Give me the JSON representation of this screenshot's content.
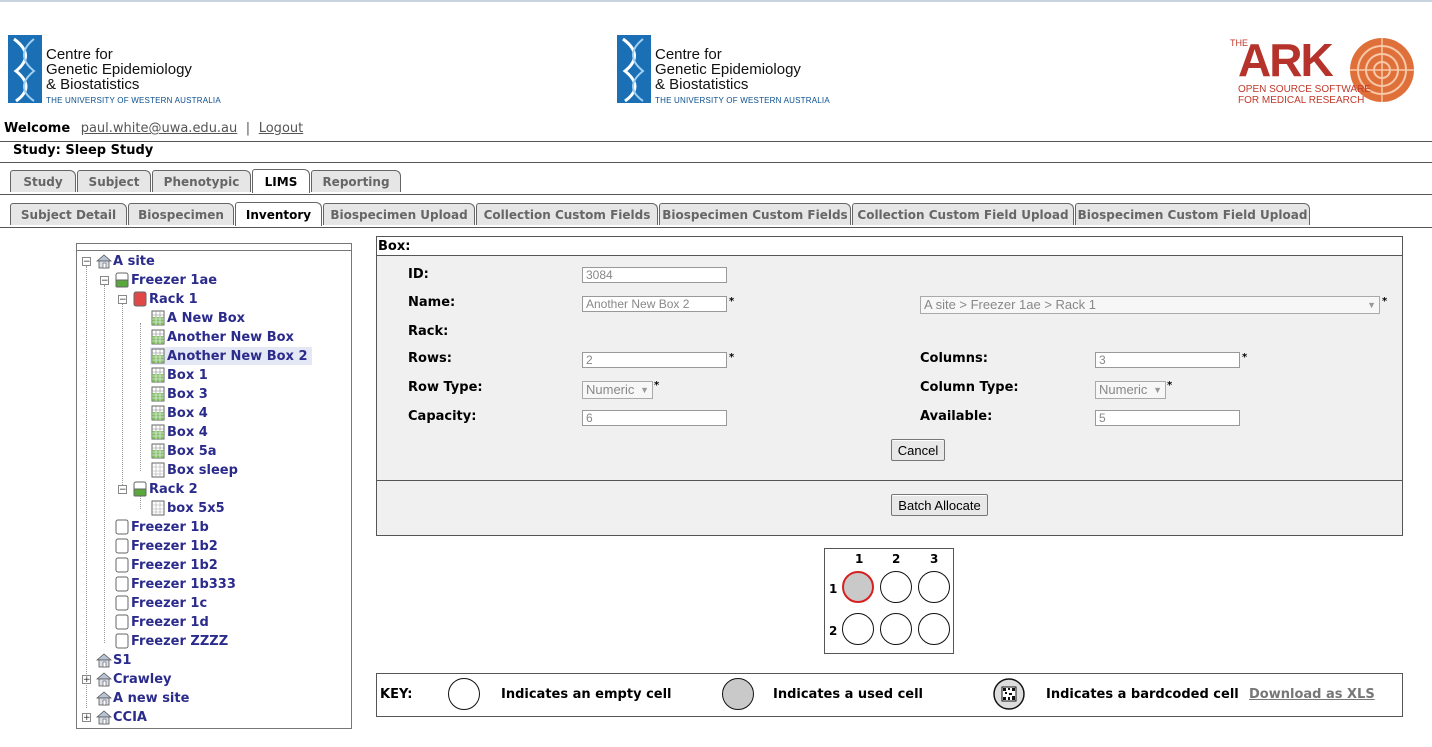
{
  "header": {
    "logo1": {
      "line1": "Centre for",
      "line2": "Genetic Epidemiology",
      "line3": "& Biostatistics",
      "line4": "THE UNIVERSITY OF WESTERN AUSTRALIA"
    },
    "logo2": {
      "line1": "Centre for",
      "line2": "Genetic Epidemiology",
      "line3": "& Biostatistics",
      "line4": "THE UNIVERSITY OF WESTERN AUSTRALIA"
    },
    "ark": {
      "the": "THE",
      "word": "ARK",
      "sub1": "OPEN SOURCE SOFTWARE",
      "sub2": "FOR MEDICAL RESEARCH"
    }
  },
  "user": {
    "welcome": "Welcome",
    "email": "paul.white@uwa.edu.au",
    "sep": "|",
    "logout": "Logout"
  },
  "study": {
    "label": "Study: Sleep Study"
  },
  "tabs": {
    "main": [
      {
        "label": "Study"
      },
      {
        "label": "Subject"
      },
      {
        "label": "Phenotypic"
      },
      {
        "label": "LIMS"
      },
      {
        "label": "Reporting"
      }
    ],
    "sub": [
      {
        "label": "Subject Detail"
      },
      {
        "label": "Biospecimen"
      },
      {
        "label": "Inventory"
      },
      {
        "label": "Biospecimen Upload"
      },
      {
        "label": "Collection Custom Fields"
      },
      {
        "label": "Biospecimen Custom Fields"
      },
      {
        "label": "Collection Custom Field Upload"
      },
      {
        "label": "Biospecimen Custom Field Upload"
      }
    ]
  },
  "tree": {
    "nodes": [
      {
        "label": "A site"
      },
      {
        "label": "Freezer 1ae"
      },
      {
        "label": "Rack 1"
      },
      {
        "label": "A New Box"
      },
      {
        "label": "Another New Box"
      },
      {
        "label": "Another New Box 2"
      },
      {
        "label": "Box 1"
      },
      {
        "label": "Box 3"
      },
      {
        "label": "Box 4"
      },
      {
        "label": "Box 4"
      },
      {
        "label": "Box 5a"
      },
      {
        "label": "Box sleep"
      },
      {
        "label": "Rack 2"
      },
      {
        "label": "box 5x5"
      },
      {
        "label": "Freezer 1b"
      },
      {
        "label": "Freezer 1b2"
      },
      {
        "label": "Freezer 1b2"
      },
      {
        "label": "Freezer 1b333"
      },
      {
        "label": "Freezer 1c"
      },
      {
        "label": "Freezer 1d"
      },
      {
        "label": "Freezer ZZZZ"
      },
      {
        "label": "S1"
      },
      {
        "label": "Crawley"
      },
      {
        "label": "A new site"
      },
      {
        "label": "CCIA"
      }
    ]
  },
  "box": {
    "title": "Box:",
    "id_label": "ID:",
    "id_value": "3084",
    "name_label": "Name:",
    "name_value": "Another New Box 2",
    "rack_path": "A site > Freezer 1ae > Rack 1",
    "rack_label": "Rack:",
    "rows_label": "Rows:",
    "rows_value": "2",
    "columns_label": "Columns:",
    "columns_value": "3",
    "rowtype_label": "Row Type:",
    "rowtype_value": "Numeric",
    "coltype_label": "Column Type:",
    "coltype_value": "Numeric",
    "capacity_label": "Capacity:",
    "capacity_value": "6",
    "available_label": "Available:",
    "available_value": "5",
    "cancel": "Cancel",
    "batch": "Batch Allocate",
    "required": "*"
  },
  "grid": {
    "col_labels": [
      "1",
      "2",
      "3"
    ],
    "row_labels": [
      "1",
      "2"
    ],
    "cells": [
      [
        "used",
        "empty",
        "empty"
      ],
      [
        "empty",
        "empty",
        "empty"
      ]
    ]
  },
  "key": {
    "label": "KEY:",
    "empty": "Indicates an empty cell",
    "used": "Indicates a used cell",
    "barcoded": "Indicates a bardcoded cell",
    "download": "Download as XLS"
  },
  "colors": {
    "tree_text": "#2b2b8c",
    "used_border": "#d62020",
    "ark_red": "#b5332b",
    "uwa_blue": "#0a4f8e"
  }
}
